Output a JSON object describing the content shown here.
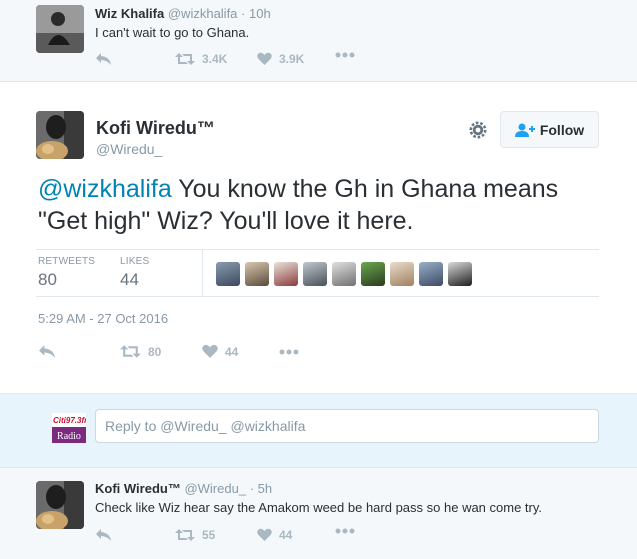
{
  "tweet_top": {
    "name": "Wiz Khalifa",
    "handle": "@wizkhalifa",
    "sep": "·",
    "time": "10h",
    "text": "I can't wait to go to Ghana.",
    "retweets": "3.4K",
    "likes": "3.9K"
  },
  "main_tweet": {
    "name": "Kofi Wiredu™",
    "handle": "@Wiredu_",
    "follow_label": "Follow",
    "mention": "@wizkhalifa",
    "text": " You know the Gh in Ghana means \"Get high\" Wiz? You'll love it here.",
    "retweets_label": "RETWEETS",
    "retweets": "80",
    "likes_label": "LIKES",
    "likes": "44",
    "timestamp": "5:29 AM - 27 Oct 2016",
    "action_retweets": "80",
    "action_likes": "44"
  },
  "reply": {
    "placeholder": "Reply to @Wiredu_ @wizkhalifa",
    "logo_top": "Citi97.3fm",
    "logo_bottom": "Radio"
  },
  "tweet_bottom": {
    "name": "Kofi Wiredu™",
    "handle": "@Wiredu_",
    "sep": "·",
    "time": "5h",
    "text": "Check like Wiz hear say the Amakom weed be hard pass so he wan come try.",
    "retweets": "55",
    "likes": "44"
  },
  "colors": {
    "link": "#0084b4",
    "muted": "#8899a6",
    "action": "#aab8c2"
  }
}
